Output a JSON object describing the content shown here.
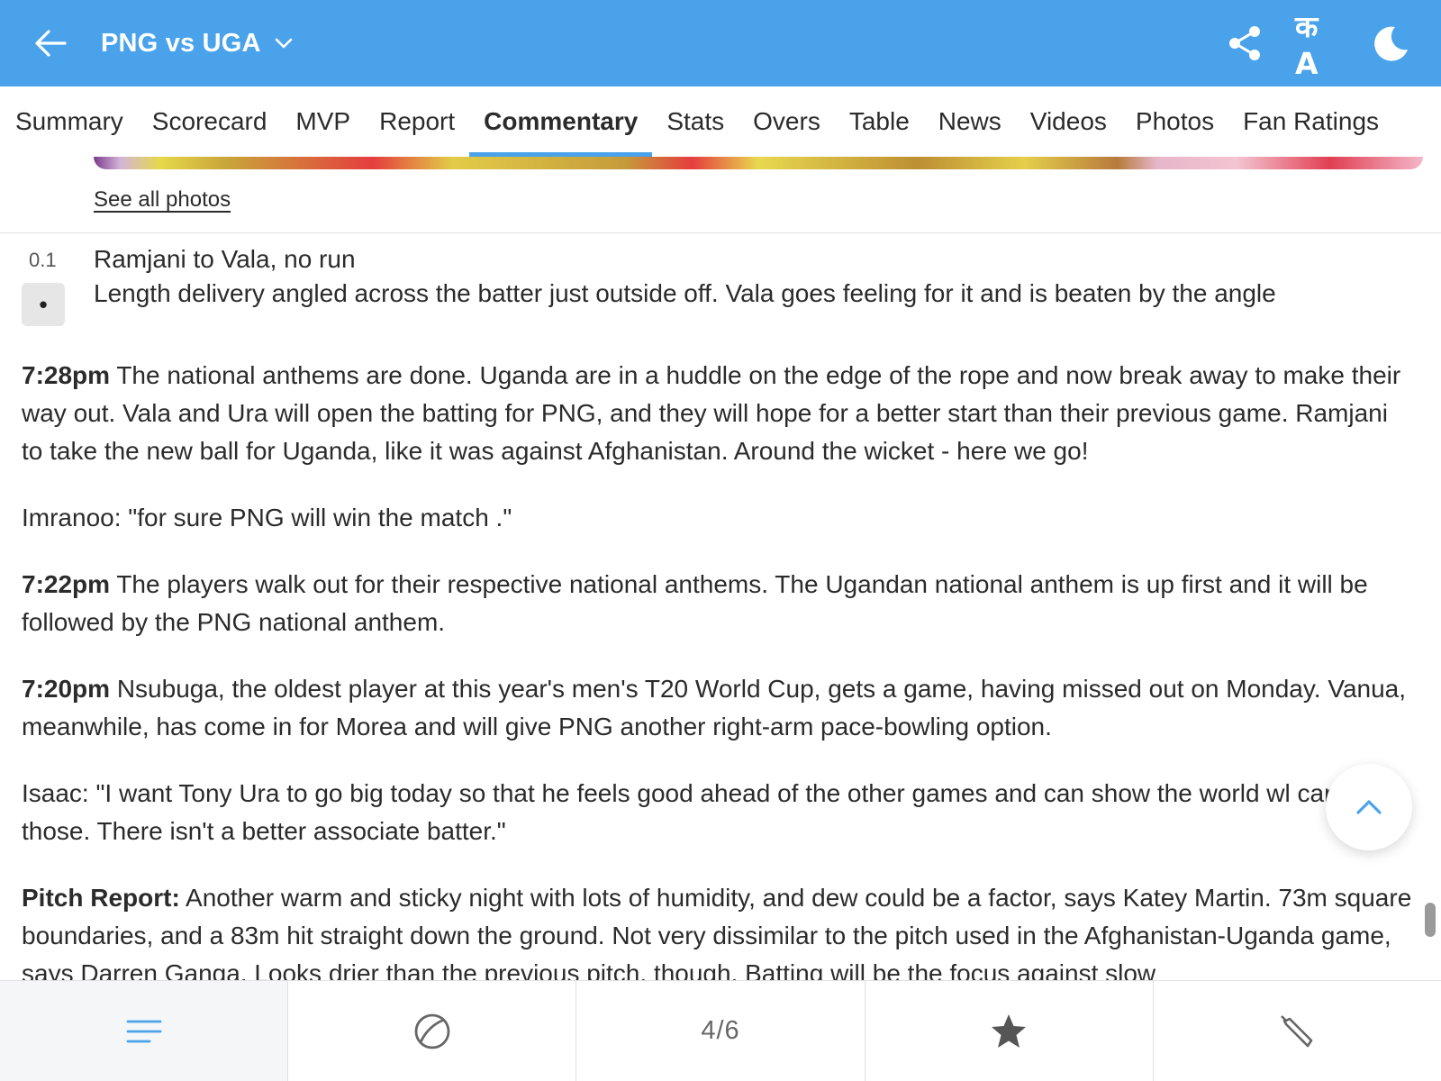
{
  "header": {
    "title": "PNG vs UGA",
    "lang_label": "क A",
    "icons": [
      "back-arrow-icon",
      "chevron-down-icon",
      "share-icon",
      "language-icon",
      "moon-icon"
    ]
  },
  "tabs": [
    {
      "label": "Summary",
      "active": false
    },
    {
      "label": "Scorecard",
      "active": false
    },
    {
      "label": "MVP",
      "active": false
    },
    {
      "label": "Report",
      "active": false
    },
    {
      "label": "Commentary",
      "active": true
    },
    {
      "label": "Stats",
      "active": false
    },
    {
      "label": "Overs",
      "active": false
    },
    {
      "label": "Table",
      "active": false
    },
    {
      "label": "News",
      "active": false
    },
    {
      "label": "Videos",
      "active": false
    },
    {
      "label": "Photos",
      "active": false
    },
    {
      "label": "Fan Ratings",
      "active": false
    }
  ],
  "photos": {
    "see_all": "See all photos"
  },
  "ball": {
    "over": "0.1",
    "result": "•",
    "title": "Ramjani to Vala, no run",
    "text": "Length delivery angled across the batter just outside off. Vala goes feeling for it and is beaten by the angle"
  },
  "commentary": [
    {
      "time": "7:28pm",
      "text": "The national anthems are done. Uganda are in a huddle on the edge of the rope and now break away to make their way out. Vala and Ura will open the batting for PNG, and they will hope for a better start than their previous game. Ramjani to take the new ball for Uganda, like it was against Afghanistan. Around the wicket - here we go!"
    },
    {
      "time": "",
      "text": "Imranoo: \"for sure PNG will win the match .\""
    },
    {
      "time": "7:22pm",
      "text": "The players walk out for their respective national anthems. The Ugandan national anthem is up first and it will be followed by the PNG national anthem."
    },
    {
      "time": "7:20pm",
      "text": "Nsubuga, the oldest player at this year's men's T20 World Cup, gets a game, having missed out on Monday. Vanua, meanwhile, has come in for Morea and will give PNG another right-arm pace-bowling option."
    },
    {
      "time": "",
      "text": "Isaac: \"I want Tony Ura to go big today so that he feels good ahead of the other games and can show the world wl can do in those. There isn't a better associate batter.\""
    },
    {
      "time": "Pitch Report:",
      "text": "Another warm and sticky night with lots of humidity, and dew could be a factor, says Katey Martin. 73m square boundaries, and a 83m hit straight down the ground. Not very dissimilar to the pitch used in the Afghanistan-Uganda game, says Darren Ganga. Looks drier than the previous pitch, though. Batting will be the focus against slow"
    }
  ],
  "bottom_nav": {
    "items": [
      "commentary-list-icon",
      "ball-icon",
      "4/6",
      "star-icon",
      "bat-icon"
    ],
    "count_label": "4/6"
  },
  "colors": {
    "header_bg": "#4aa3ea",
    "accent": "#4aa3ea"
  }
}
